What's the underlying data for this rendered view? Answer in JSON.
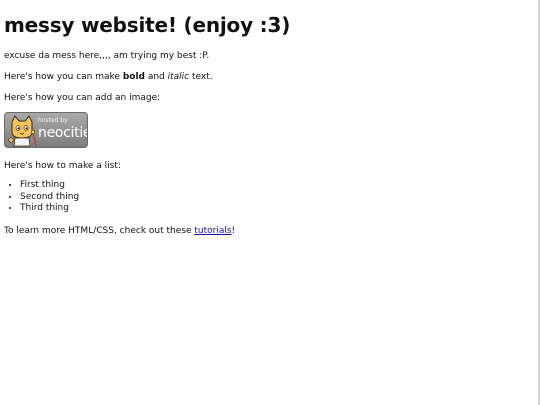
{
  "page": {
    "title": "messy website! (enjoy :3)",
    "intro": "excuse da mess here,,,, am trying my best :P.",
    "format_line": {
      "prefix": "Here's how you can make ",
      "bold": "bold",
      "middle": " and ",
      "italic": "italic",
      "suffix": " text."
    },
    "image_line": "Here's how you can add an image:",
    "badge": {
      "small_text": "hosted by",
      "brand_text": "neocities"
    },
    "list_intro": "Here's how to make a list:",
    "list_items": [
      "First thing",
      "Second thing",
      "Third thing"
    ],
    "learn_line": {
      "prefix": "To learn more HTML/CSS, check out these ",
      "link": "tutorials",
      "suffix": "!"
    }
  }
}
